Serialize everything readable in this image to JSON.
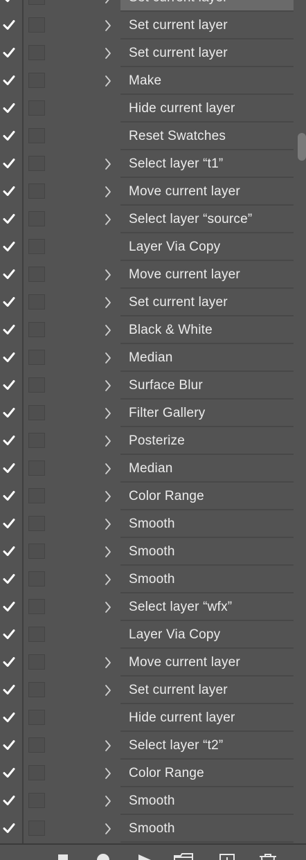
{
  "panel": {
    "colors": {
      "background": "#535353",
      "text": "#ececec",
      "checkmark": "#ffffff",
      "chevron": "#d0d0d0"
    }
  },
  "steps": [
    {
      "label": "Set current layer",
      "expandable": true,
      "selected": true
    },
    {
      "label": "Set current layer",
      "expandable": true
    },
    {
      "label": "Set current layer",
      "expandable": true
    },
    {
      "label": "Make",
      "expandable": true
    },
    {
      "label": "Hide current layer",
      "expandable": false
    },
    {
      "label": "Reset Swatches",
      "expandable": false
    },
    {
      "label": "Select layer “t1”",
      "expandable": true
    },
    {
      "label": "Move current layer",
      "expandable": true
    },
    {
      "label": "Select layer “source”",
      "expandable": true
    },
    {
      "label": "Layer Via Copy",
      "expandable": false
    },
    {
      "label": "Move current layer",
      "expandable": true
    },
    {
      "label": "Set current layer",
      "expandable": true
    },
    {
      "label": "Black & White",
      "expandable": true
    },
    {
      "label": "Median",
      "expandable": true
    },
    {
      "label": "Surface Blur",
      "expandable": true
    },
    {
      "label": "Filter Gallery",
      "expandable": true
    },
    {
      "label": "Posterize",
      "expandable": true
    },
    {
      "label": "Median",
      "expandable": true
    },
    {
      "label": "Color Range",
      "expandable": true
    },
    {
      "label": "Smooth",
      "expandable": true
    },
    {
      "label": "Smooth",
      "expandable": true
    },
    {
      "label": "Smooth",
      "expandable": true
    },
    {
      "label": "Select layer “wfx”",
      "expandable": true
    },
    {
      "label": "Layer Via Copy",
      "expandable": false
    },
    {
      "label": "Move current layer",
      "expandable": true
    },
    {
      "label": "Set current layer",
      "expandable": true
    },
    {
      "label": "Hide current layer",
      "expandable": false
    },
    {
      "label": "Select layer “t2”",
      "expandable": true
    },
    {
      "label": "Color Range",
      "expandable": true
    },
    {
      "label": "Smooth",
      "expandable": true
    },
    {
      "label": "Smooth",
      "expandable": true
    }
  ],
  "footer": {
    "icons": [
      "stop-icon",
      "record-icon",
      "play-icon",
      "folder-icon",
      "new-action-icon",
      "trash-icon"
    ]
  }
}
